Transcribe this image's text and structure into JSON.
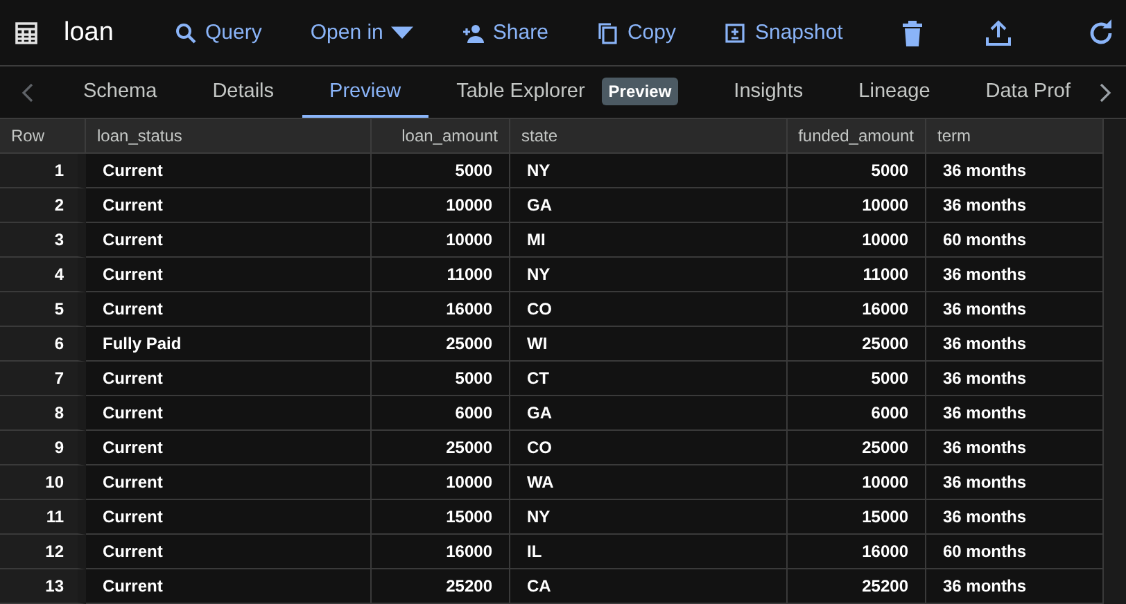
{
  "title": "loan",
  "actions": [
    {
      "kind": "search",
      "label": "Query"
    },
    {
      "kind": "dropdown",
      "label": "Open in"
    },
    {
      "kind": "share",
      "label": "Share"
    },
    {
      "kind": "copy",
      "label": "Copy"
    },
    {
      "kind": "snapshot",
      "label": "Snapshot"
    }
  ],
  "tabs": [
    {
      "label": "Schema",
      "selected": false
    },
    {
      "label": "Details",
      "selected": false
    },
    {
      "label": "Preview",
      "selected": true
    },
    {
      "label": "Table Explorer",
      "selected": false,
      "badge": "Preview"
    },
    {
      "label": "Insights",
      "selected": false
    },
    {
      "label": "Lineage",
      "selected": false
    },
    {
      "label": "Data Prof",
      "selected": false
    }
  ],
  "table": {
    "columns": [
      {
        "label": "Row",
        "kind": "index"
      },
      {
        "label": "loan_status",
        "kind": "text"
      },
      {
        "label": "loan_amount",
        "kind": "number"
      },
      {
        "label": "state",
        "kind": "text"
      },
      {
        "label": "funded_amount",
        "kind": "number"
      },
      {
        "label": "term",
        "kind": "text"
      }
    ],
    "rows": [
      [
        "1",
        "Current",
        "5000",
        "NY",
        "5000",
        "36 months"
      ],
      [
        "2",
        "Current",
        "10000",
        "GA",
        "10000",
        "36 months"
      ],
      [
        "3",
        "Current",
        "10000",
        "MI",
        "10000",
        "60 months"
      ],
      [
        "4",
        "Current",
        "11000",
        "NY",
        "11000",
        "36 months"
      ],
      [
        "5",
        "Current",
        "16000",
        "CO",
        "16000",
        "36 months"
      ],
      [
        "6",
        "Fully Paid",
        "25000",
        "WI",
        "25000",
        "36 months"
      ],
      [
        "7",
        "Current",
        "5000",
        "CT",
        "5000",
        "36 months"
      ],
      [
        "8",
        "Current",
        "6000",
        "GA",
        "6000",
        "36 months"
      ],
      [
        "9",
        "Current",
        "25000",
        "CO",
        "25000",
        "36 months"
      ],
      [
        "10",
        "Current",
        "10000",
        "WA",
        "10000",
        "36 months"
      ],
      [
        "11",
        "Current",
        "15000",
        "NY",
        "15000",
        "36 months"
      ],
      [
        "12",
        "Current",
        "16000",
        "IL",
        "16000",
        "60 months"
      ],
      [
        "13",
        "Current",
        "25200",
        "CA",
        "25200",
        "36 months"
      ]
    ]
  }
}
